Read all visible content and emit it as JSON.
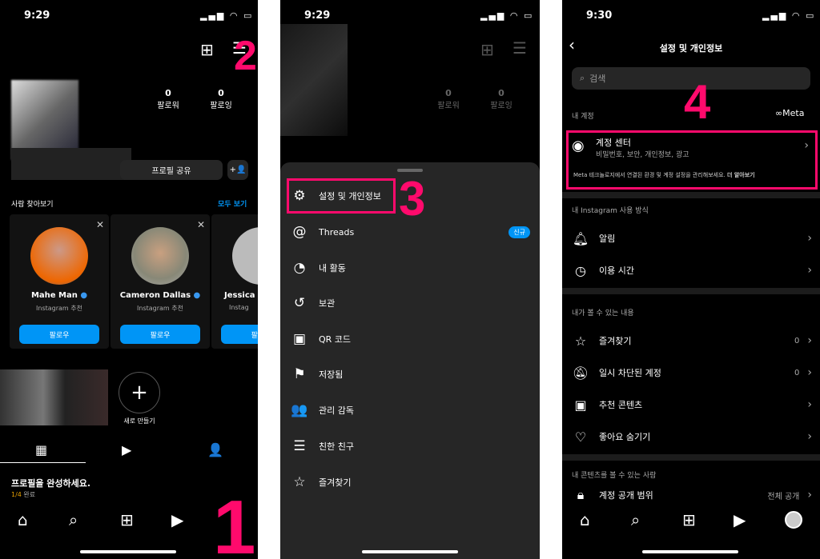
{
  "panel1": {
    "time": "9:29",
    "stats": [
      {
        "value": "0",
        "label": "팔로워"
      },
      {
        "value": "0",
        "label": "팔로잉"
      }
    ],
    "share_profile": "프로필 공유",
    "discover_title": "사람 찾아보기",
    "see_all": "모두 보기",
    "cards": [
      {
        "name": "Mahe Man",
        "sub": "Instagram 추천",
        "follow": "팔로우"
      },
      {
        "name": "Cameron Dallas",
        "sub": "Instagram 추천",
        "follow": "팔로우"
      },
      {
        "name": "Jessica I",
        "sub": "Instag",
        "follow": "팔로우"
      }
    ],
    "new_highlight": "새로 만들기",
    "complete_title": "프로필을 완성하세요.",
    "progress": "1/4",
    "progress_suffix": "완료",
    "marker_1": "1",
    "marker_2": "2"
  },
  "panel2": {
    "time": "9:29",
    "stats": [
      {
        "value": "0",
        "label": "팔로워"
      },
      {
        "value": "0",
        "label": "팔로잉"
      }
    ],
    "menu": [
      {
        "icon": "settings-icon",
        "label": "설정 및 개인정보"
      },
      {
        "icon": "threads-icon",
        "label": "Threads",
        "badge": "신규"
      },
      {
        "icon": "activity-icon",
        "label": "내 활동"
      },
      {
        "icon": "archive-icon",
        "label": "보관"
      },
      {
        "icon": "qr-icon",
        "label": "QR 코드"
      },
      {
        "icon": "bookmark-icon",
        "label": "저장됨"
      },
      {
        "icon": "supervision-icon",
        "label": "관리 감독"
      },
      {
        "icon": "close-friends-icon",
        "label": "친한 친구"
      },
      {
        "icon": "star-icon",
        "label": "즐겨찾기"
      }
    ],
    "marker_3": "3"
  },
  "panel3": {
    "time": "9:30",
    "title": "설정 및 개인정보",
    "search_placeholder": "검색",
    "my_account": "내 계정",
    "meta_logo": "Meta",
    "account_center": {
      "title": "계정 센터",
      "sub": "비밀번호, 보안, 개인정보, 광고",
      "note": "Meta 테크놀로지에서 연결된 환경 및 계정 설정을 관리해보세요.",
      "learn_more": "더 알아보기"
    },
    "section_usage": "내 Instagram 사용 방식",
    "usage_items": [
      {
        "label": "알림"
      },
      {
        "label": "이용 시간"
      }
    ],
    "section_see": "내가 볼 수 있는 내용",
    "see_items": [
      {
        "label": "즐겨찾기",
        "count": "0"
      },
      {
        "label": "일시 차단된 계정",
        "count": "0"
      },
      {
        "label": "추천 콘텐츠"
      },
      {
        "label": "좋아요 숨기기"
      }
    ],
    "section_who": "내 콘텐츠를 볼 수 있는 사람",
    "privacy": {
      "label": "계정 공개 범위",
      "value": "전체 공개"
    },
    "marker_4": "4"
  },
  "colors": {
    "accent": "#0095f6",
    "highlight": "#ff0a6c"
  }
}
